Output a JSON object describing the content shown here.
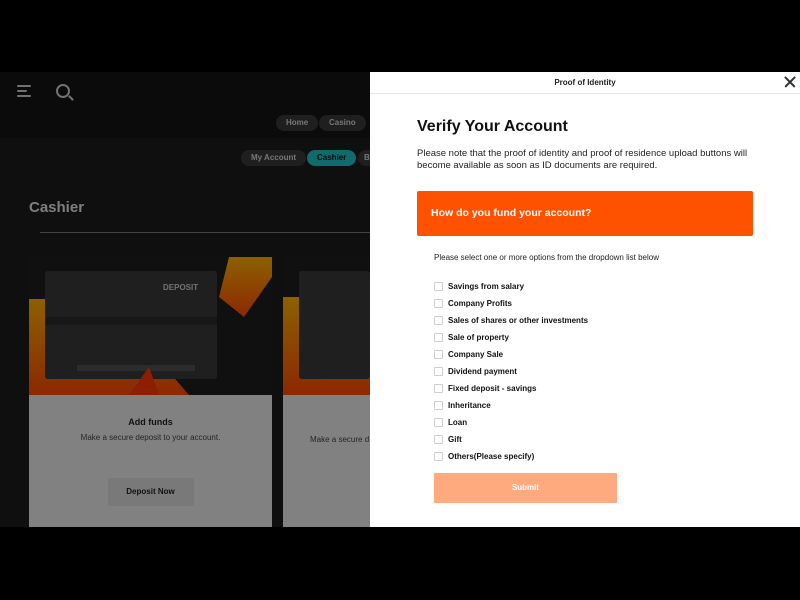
{
  "background": {
    "nav_pills": [
      "Home",
      "Casino"
    ],
    "account_tabs": [
      "My Account",
      "Cashier",
      "B"
    ],
    "page_title": "Cashier",
    "cards": [
      {
        "art_label": "DEPOSIT",
        "title": "Add funds",
        "description": "Make a secure deposit to your account.",
        "button": "Deposit Now"
      },
      {
        "description": "Make a secure d"
      }
    ]
  },
  "modal": {
    "header": "Proof of Identity",
    "title": "Verify Your Account",
    "note": "Please note that the proof of identity and proof of residence upload buttons will become available as soon as ID documents are required.",
    "question": "How do you fund your account?",
    "hint": "Please select one or more options from the dropdown list below",
    "options": [
      "Savings from salary",
      "Company Profits",
      "Sales of shares or other investments",
      "Sale of property",
      "Company Sale",
      "Dividend payment",
      "Fixed deposit - savings",
      "Inheritance",
      "Loan",
      "Gift",
      "Others(Please specify)"
    ],
    "submit": "Submit"
  },
  "colors": {
    "accent": "#ff5200",
    "submit_disabled": "#ffa97f",
    "active_tab": "#1ec3c3"
  }
}
